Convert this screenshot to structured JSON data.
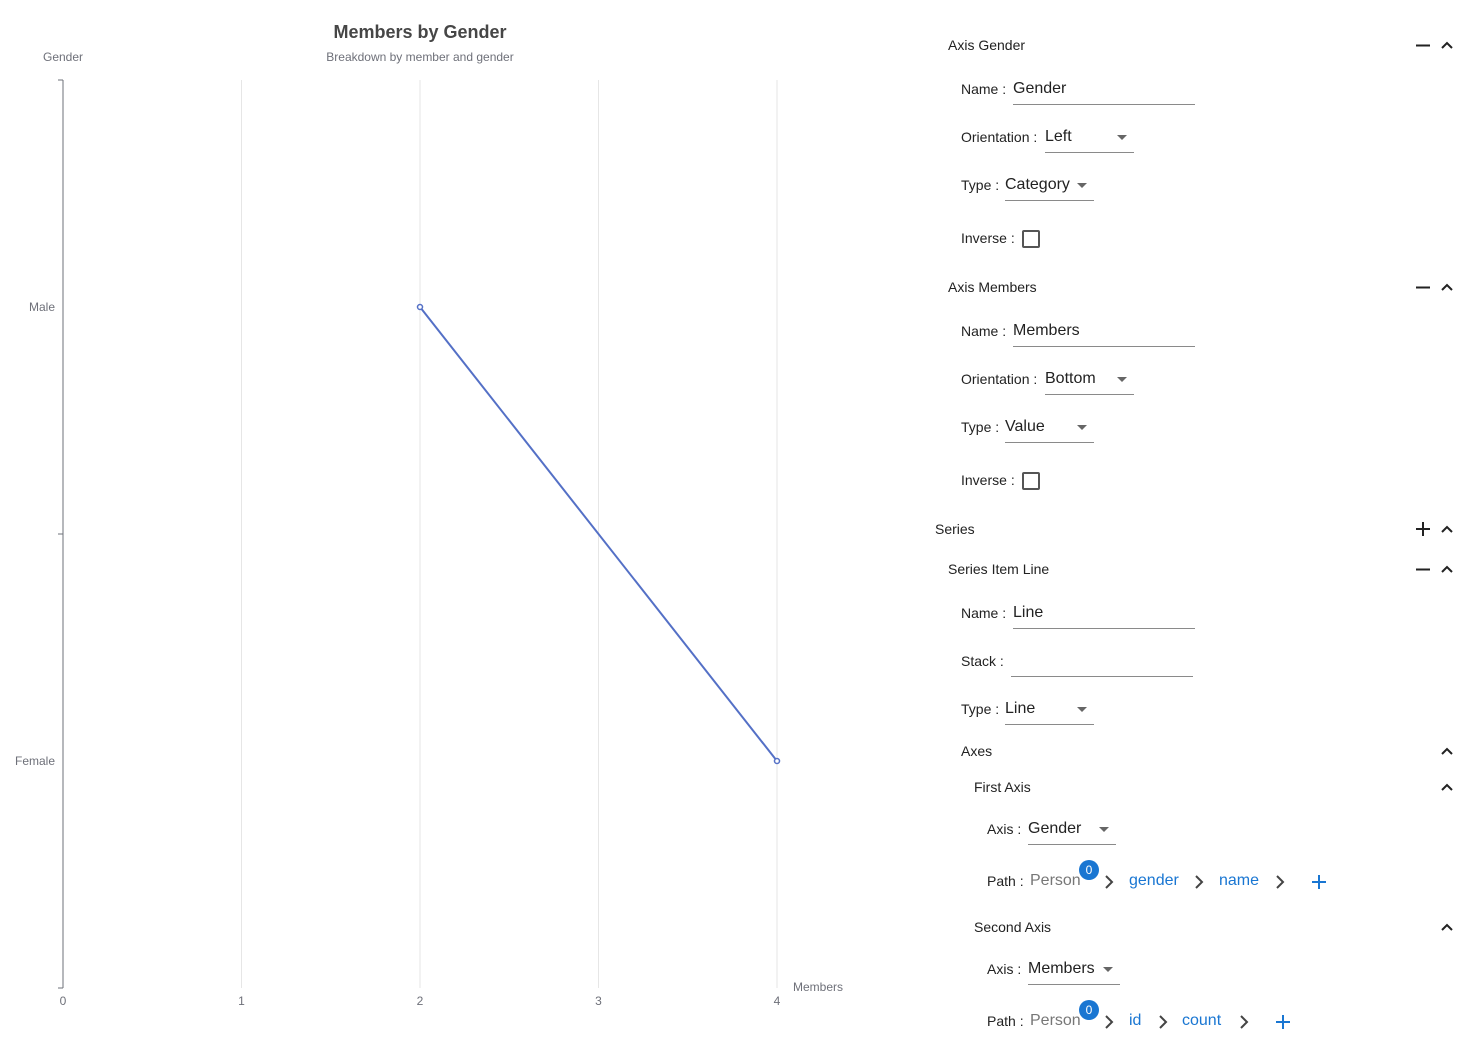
{
  "chart_data": {
    "type": "line",
    "title": "Members by Gender",
    "subtitle": "Breakdown by member and gender",
    "ylabel": "Gender",
    "xlabel": "Members",
    "categories": [
      "Male",
      "Female"
    ],
    "xticks": [
      "0",
      "1",
      "2",
      "3",
      "4"
    ],
    "xlim": [
      0,
      4
    ],
    "series": [
      {
        "name": "Line",
        "points": [
          {
            "y": "Male",
            "x": 2
          },
          {
            "y": "Female",
            "x": 4
          }
        ]
      }
    ],
    "series_color": "#5470c6",
    "grid": true
  },
  "panel": {
    "axis_gender": {
      "title": "Axis Gender",
      "name_label": "Name",
      "name_value": "Gender",
      "orientation_label": "Orientation",
      "orientation_value": "Left",
      "type_label": "Type",
      "type_value": "Category",
      "inverse_label": "Inverse"
    },
    "axis_members": {
      "title": "Axis Members",
      "name_label": "Name",
      "name_value": "Members",
      "orientation_label": "Orientation",
      "orientation_value": "Bottom",
      "type_label": "Type",
      "type_value": "Value",
      "inverse_label": "Inverse"
    },
    "series": {
      "title": "Series",
      "item": {
        "title": "Series Item Line",
        "name_label": "Name",
        "name_value": "Line",
        "stack_label": "Stack",
        "stack_value": "",
        "type_label": "Type",
        "type_value": "Line",
        "axes_title": "Axes",
        "first_axis": {
          "title": "First Axis",
          "axis_label": "Axis",
          "axis_value": "Gender",
          "path_label": "Path",
          "path_root": "Person",
          "badge": "0",
          "path_segments": [
            "gender",
            "name"
          ]
        },
        "second_axis": {
          "title": "Second Axis",
          "axis_label": "Axis",
          "axis_value": "Members",
          "path_label": "Path",
          "path_root": "Person",
          "badge": "0",
          "path_segments": [
            "id",
            "count"
          ]
        }
      }
    },
    "separator": ":"
  },
  "icons": [
    "minus-icon",
    "chevron-up-icon",
    "plus-icon",
    "chevron-right-icon",
    "dropdown-arrow-icon"
  ],
  "colors": {
    "accent": "#1976d2",
    "series": "#5470c6"
  }
}
